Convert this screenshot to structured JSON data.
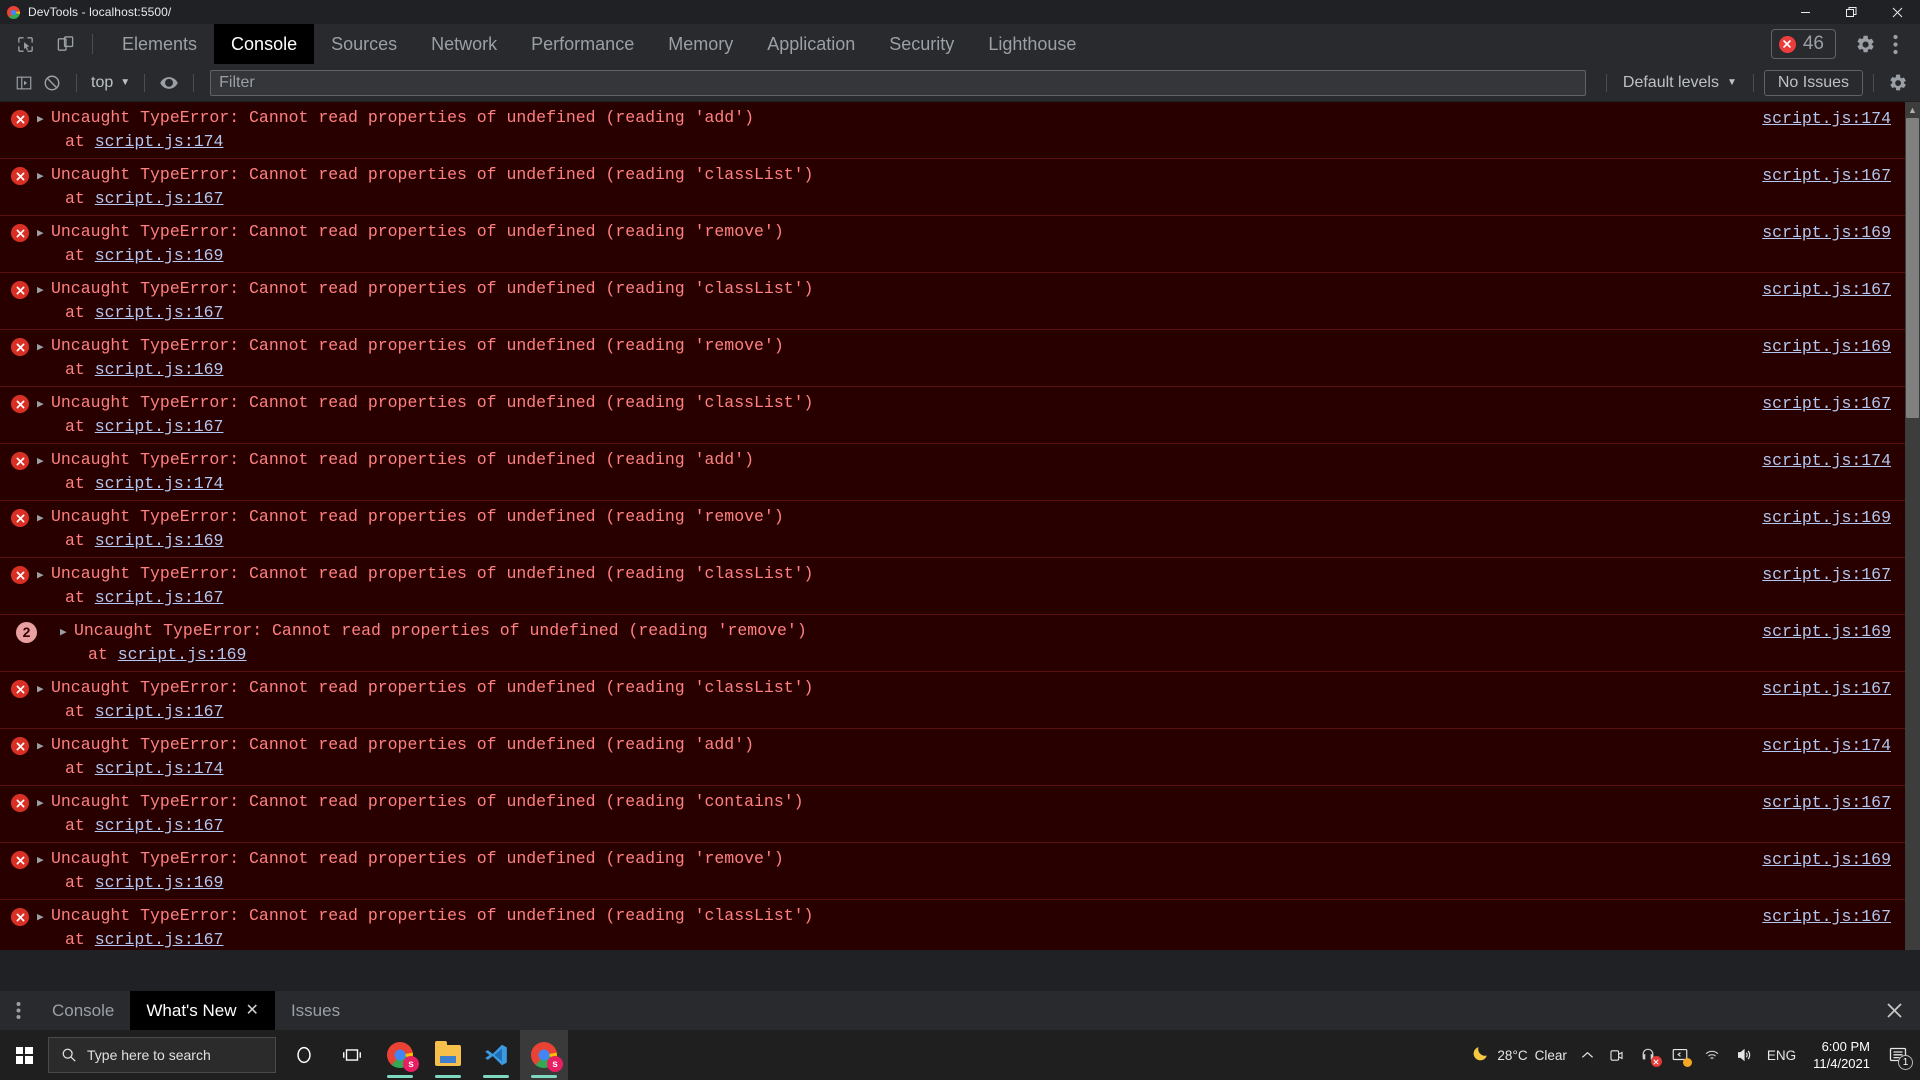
{
  "window": {
    "title": "DevTools - localhost:5500/",
    "app_icon": "chrome-icon",
    "controls": {
      "minimize": "minimize-icon",
      "restore": "restore-icon",
      "close": "close-icon"
    }
  },
  "devtools": {
    "left_icons": [
      {
        "name": "inspect-element-icon"
      },
      {
        "name": "device-toolbar-icon"
      }
    ],
    "tabs": [
      {
        "label": "Elements",
        "active": false
      },
      {
        "label": "Console",
        "active": true
      },
      {
        "label": "Sources",
        "active": false
      },
      {
        "label": "Network",
        "active": false
      },
      {
        "label": "Performance",
        "active": false
      },
      {
        "label": "Memory",
        "active": false
      },
      {
        "label": "Application",
        "active": false
      },
      {
        "label": "Security",
        "active": false
      },
      {
        "label": "Lighthouse",
        "active": false
      }
    ],
    "error_badge": {
      "count": "46",
      "icon": "error-x-icon"
    },
    "settings_icon": "gear-icon",
    "more_icon": "kebab-menu-icon"
  },
  "console_toolbar": {
    "sidebar_toggle_icon": "console-sidebar-icon",
    "clear_icon": "clear-console-icon",
    "context_selector": "top",
    "eye_icon": "live-expression-eye-icon",
    "filter": {
      "value": "",
      "placeholder": "Filter"
    },
    "levels_label": "Default levels",
    "issues_label": "No Issues",
    "settings_icon": "gear-icon"
  },
  "console_messages": [
    {
      "icon": "error",
      "text": "Uncaught TypeError: Cannot read properties of undefined (reading 'add')",
      "stack_prefix": "at ",
      "stack_link": "script.js:174",
      "source": "script.js:174"
    },
    {
      "icon": "error",
      "text": "Uncaught TypeError: Cannot read properties of undefined (reading 'classList')",
      "stack_prefix": "at ",
      "stack_link": "script.js:167",
      "source": "script.js:167"
    },
    {
      "icon": "error",
      "text": "Uncaught TypeError: Cannot read properties of undefined (reading 'remove')",
      "stack_prefix": "at ",
      "stack_link": "script.js:169",
      "source": "script.js:169"
    },
    {
      "icon": "error",
      "text": "Uncaught TypeError: Cannot read properties of undefined (reading 'classList')",
      "stack_prefix": "at ",
      "stack_link": "script.js:167",
      "source": "script.js:167"
    },
    {
      "icon": "error",
      "text": "Uncaught TypeError: Cannot read properties of undefined (reading 'remove')",
      "stack_prefix": "at ",
      "stack_link": "script.js:169",
      "source": "script.js:169"
    },
    {
      "icon": "error",
      "text": "Uncaught TypeError: Cannot read properties of undefined (reading 'classList')",
      "stack_prefix": "at ",
      "stack_link": "script.js:167",
      "source": "script.js:167"
    },
    {
      "icon": "error",
      "text": "Uncaught TypeError: Cannot read properties of undefined (reading 'add')",
      "stack_prefix": "at ",
      "stack_link": "script.js:174",
      "source": "script.js:174"
    },
    {
      "icon": "error",
      "text": "Uncaught TypeError: Cannot read properties of undefined (reading 'remove')",
      "stack_prefix": "at ",
      "stack_link": "script.js:169",
      "source": "script.js:169"
    },
    {
      "icon": "error",
      "text": "Uncaught TypeError: Cannot read properties of undefined (reading 'classList')",
      "stack_prefix": "at ",
      "stack_link": "script.js:167",
      "source": "script.js:167"
    },
    {
      "icon": "count",
      "count": "2",
      "text": "Uncaught TypeError: Cannot read properties of undefined (reading 'remove')",
      "stack_prefix": "at ",
      "stack_link": "script.js:169",
      "source": "script.js:169"
    },
    {
      "icon": "error",
      "text": "Uncaught TypeError: Cannot read properties of undefined (reading 'classList')",
      "stack_prefix": "at ",
      "stack_link": "script.js:167",
      "source": "script.js:167"
    },
    {
      "icon": "error",
      "text": "Uncaught TypeError: Cannot read properties of undefined (reading 'add')",
      "stack_prefix": "at ",
      "stack_link": "script.js:174",
      "source": "script.js:174"
    },
    {
      "icon": "error",
      "text": "Uncaught TypeError: Cannot read properties of undefined (reading 'contains')",
      "stack_prefix": "at ",
      "stack_link": "script.js:167",
      "source": "script.js:167"
    },
    {
      "icon": "error",
      "text": "Uncaught TypeError: Cannot read properties of undefined (reading 'remove')",
      "stack_prefix": "at ",
      "stack_link": "script.js:169",
      "source": "script.js:169"
    },
    {
      "icon": "error",
      "text": "Uncaught TypeError: Cannot read properties of undefined (reading 'classList')",
      "stack_prefix": "at ",
      "stack_link": "script.js:167",
      "source": "script.js:167"
    }
  ],
  "drawer": {
    "more_icon": "kebab-menu-icon",
    "tabs": [
      {
        "label": "Console",
        "active": false,
        "closable": false
      },
      {
        "label": "What's New",
        "active": true,
        "closable": true
      },
      {
        "label": "Issues",
        "active": false,
        "closable": false
      }
    ],
    "close_icon": "close-icon"
  },
  "taskbar": {
    "start_icon": "windows-start-icon",
    "search": {
      "placeholder": "Type here to search",
      "icon": "search-icon"
    },
    "pinned": [
      {
        "name": "cortana-icon"
      },
      {
        "name": "task-view-icon"
      },
      {
        "name": "chrome-icon",
        "badge": "s"
      },
      {
        "name": "file-explorer-icon"
      },
      {
        "name": "vscode-icon"
      },
      {
        "name": "chrome-icon",
        "badge": "s",
        "active": true
      }
    ],
    "tray": {
      "weather": {
        "icon": "moon-icon",
        "temperature": "28°C",
        "condition": "Clear"
      },
      "overflow_icon": "chevron-up-icon",
      "icons": [
        {
          "name": "camera-icon"
        },
        {
          "name": "headset-muted-icon"
        },
        {
          "name": "display-cast-icon"
        },
        {
          "name": "wifi-icon"
        },
        {
          "name": "volume-icon"
        }
      ],
      "language": "ENG",
      "time": "6:00 PM",
      "date": "11/4/2021",
      "notifications": {
        "icon": "notification-icon",
        "badge": "1"
      }
    }
  },
  "colors": {
    "error_bg": "#290000",
    "error_text": "#ff8080",
    "link": "#b3c7f0",
    "chrome_bg": "#282a2d",
    "active_tab_bg": "#000000"
  }
}
